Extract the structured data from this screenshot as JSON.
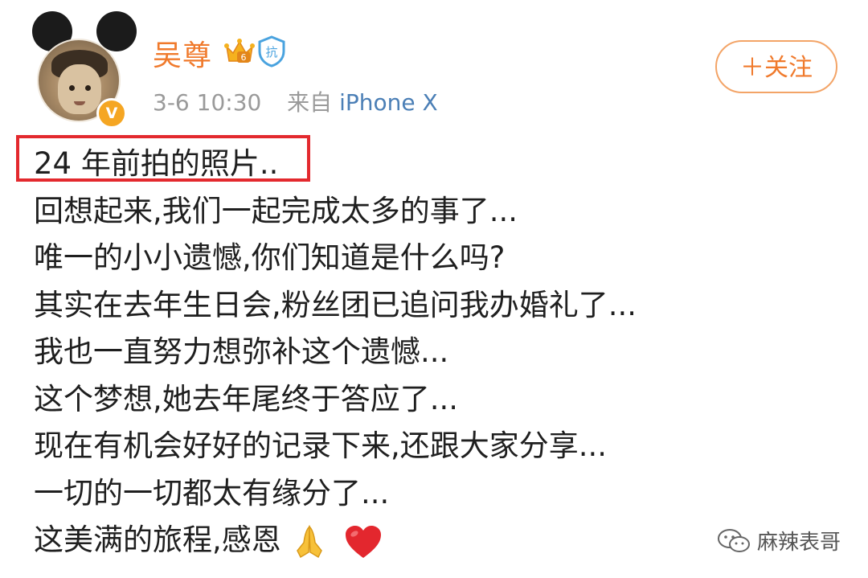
{
  "post": {
    "author_name": "吴尊",
    "timestamp": "3-6 10:30",
    "source_prefix": "来自",
    "source_device": "iPhone X",
    "verified_badge": "V",
    "follow_label": "＋关注",
    "lines": [
      "24 年前拍的照片..",
      "回想起来,我们一起完成太多的事了...",
      "唯一的小小遗憾,你们知道是什么吗?",
      "其实在去年生日会,粉丝团已追问我办婚礼了...",
      "我也一直努力想弥补这个遗憾...",
      "这个梦想,她去年尾终于答应了...",
      "现在有机会好好的记录下来,还跟大家分享...",
      "一切的一切都太有缘分了...",
      "这美满的旅程,感恩"
    ],
    "trailing_icons": [
      "praying-hands-icon",
      "red-heart-icon"
    ]
  },
  "icons": {
    "crown_badge": "crown-icon",
    "level_badge_text": "6",
    "shield_badge_text": "抗"
  },
  "watermark": {
    "text": "麻辣表哥",
    "icon": "wechat-icon"
  },
  "colors": {
    "name": "#f07a2c",
    "source_link": "#4b7fb6",
    "highlight": "#e3292e",
    "follow_border": "#f3a467"
  }
}
